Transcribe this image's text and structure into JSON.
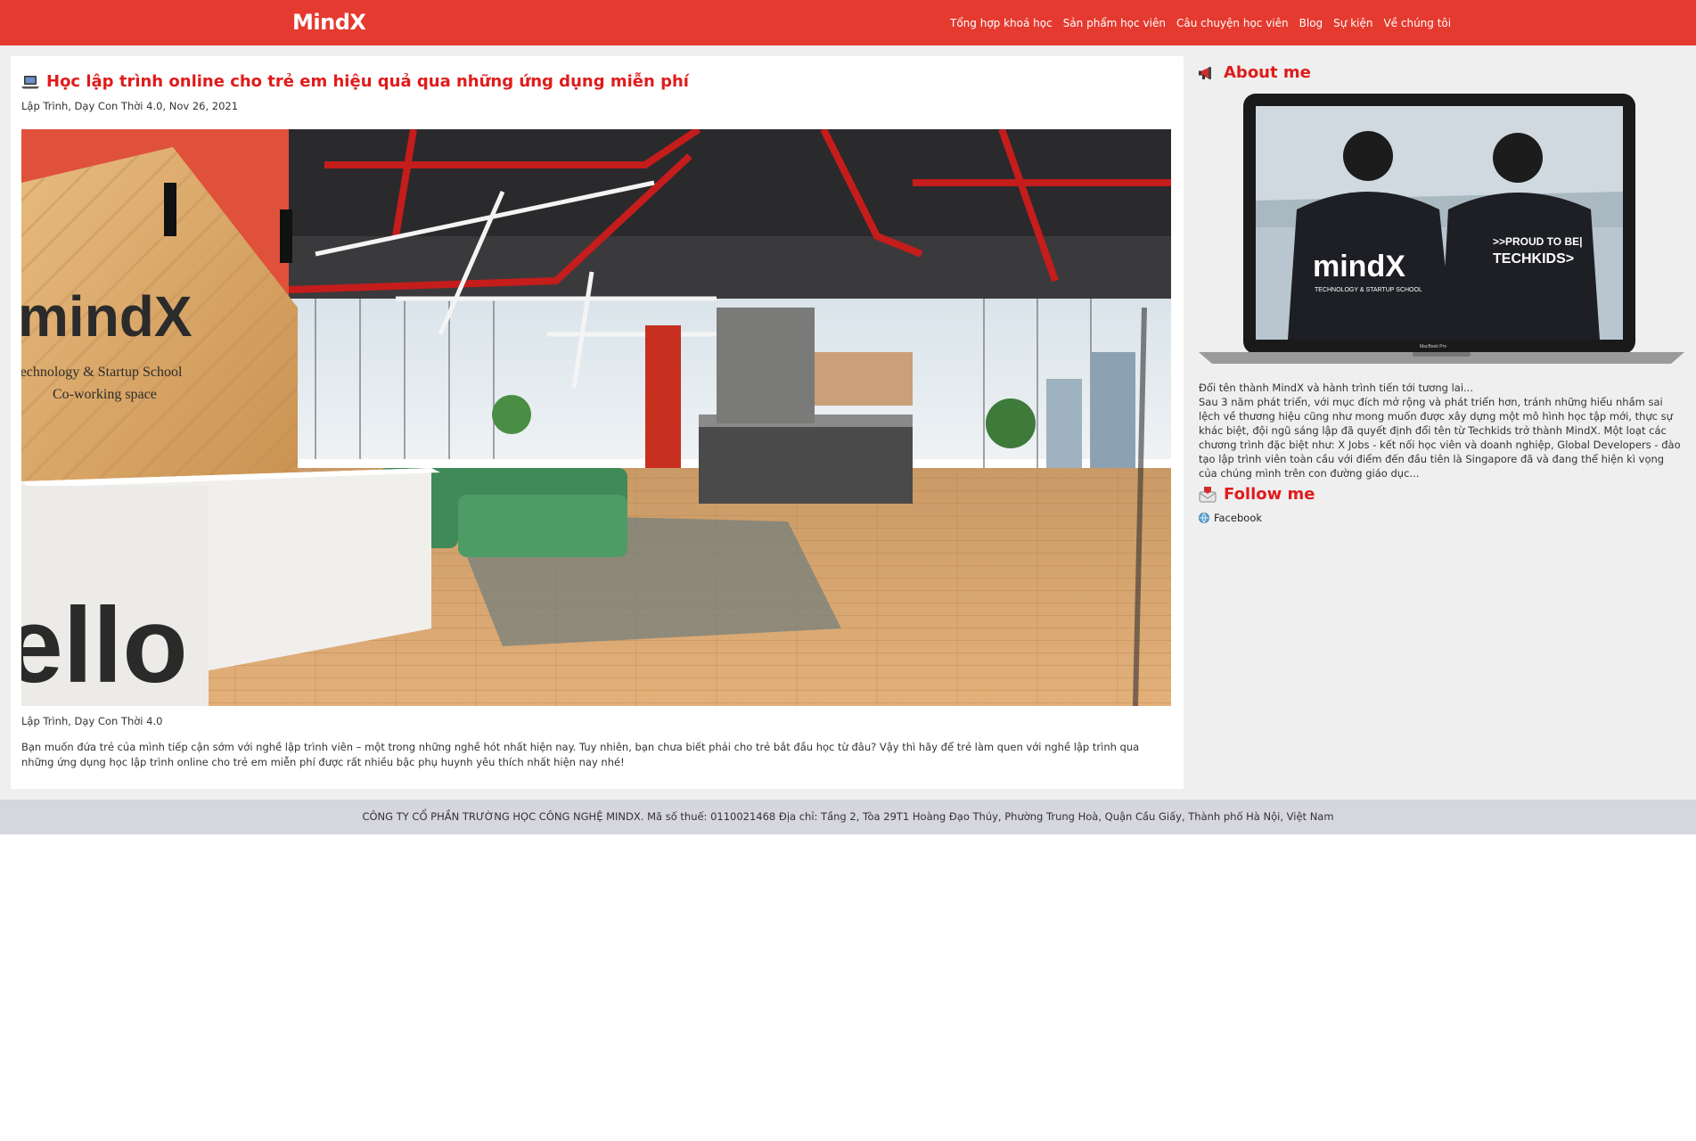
{
  "header": {
    "brand": "MindX",
    "nav": [
      "Tổng hợp khoá học",
      "Sản phẩm học viên",
      "Câu chuyện học viên",
      "Blog",
      "Sự kiện",
      "Về chúng tôi"
    ]
  },
  "article": {
    "title": "Học lập trình online cho trẻ em hiệu quả qua những ứng dụng miễn phí",
    "meta": "Lập Trình, Dạy Con Thời 4.0, Nov 26, 2021",
    "hero_image_text": {
      "brand": "mindX",
      "subtitle": "Technology & Startup School",
      "line3": "Co-working space",
      "desk_word": "ello"
    },
    "categories": "Lập Trình, Dạy Con Thời 4.0",
    "excerpt": "Bạn muốn đứa trẻ của mình tiếp cận sớm với nghề lập trình viên – một trong những nghề hót nhất hiện nay. Tuy nhiên, bạn chưa biết phải cho trẻ bắt đầu học từ đâu? Vậy thì hãy để trẻ làm quen với nghề lập trình qua những ứng dụng học lập trình online cho trẻ em miễn phí được rất nhiều bậc phụ huynh yêu thích nhất hiện nay nhé!"
  },
  "sidebar": {
    "about_title": "About me",
    "about_image_text": {
      "shirt_left": "mindX",
      "shirt_left_sub": "TECHNOLOGY & STARTUP SCHOOL",
      "shirt_right_top": ">>PROUD TO BE|",
      "shirt_right_bottom": "TECHKIDS>",
      "laptop_label": "MacBook Pro"
    },
    "about_text": "Đổi tên thành MindX và hành trình tiến tới tương lai...\nSau 3 năm phát triển, với mục đích mở rộng và phát triển hơn, tránh những hiểu nhầm sai lệch về thương hiệu cũng như mong muốn được xây dựng một mô hình học tập mới, thực sự khác biệt, đội ngũ sáng lập đã quyết định đổi tên từ Techkids trở thành MindX. Một loạt các chương trình đặc biệt như: X Jobs - kết nối học viên và doanh nghiệp, Global Developers - đào tạo lập trình viên toàn cầu với điểm đến đầu tiên là Singapore đã và đang thể hiện kì vọng của chúng mình trên con đường giáo dục...",
    "follow_title": "Follow me",
    "links": [
      "Facebook"
    ]
  },
  "footer": {
    "text": "CÔNG TY CỔ PHẦN TRƯỜNG HỌC CÔNG NGHỆ MINDX. Mã số thuế: 0110021468 Địa chỉ: Tầng 2, Tòa 29T1 Hoàng Đạo Thúy, Phường Trung Hoà, Quận Cầu Giấy, Thành phố Hà Nội, Việt Nam"
  },
  "colors": {
    "brand_red": "#e53a2f",
    "title_red": "#e01b1b",
    "page_bg": "#efefef",
    "footer_bg": "#d6d6de"
  },
  "icons": {
    "title": "laptop-icon",
    "about": "megaphone-icon",
    "follow": "mailbox-icon",
    "facebook": "globe-icon"
  }
}
